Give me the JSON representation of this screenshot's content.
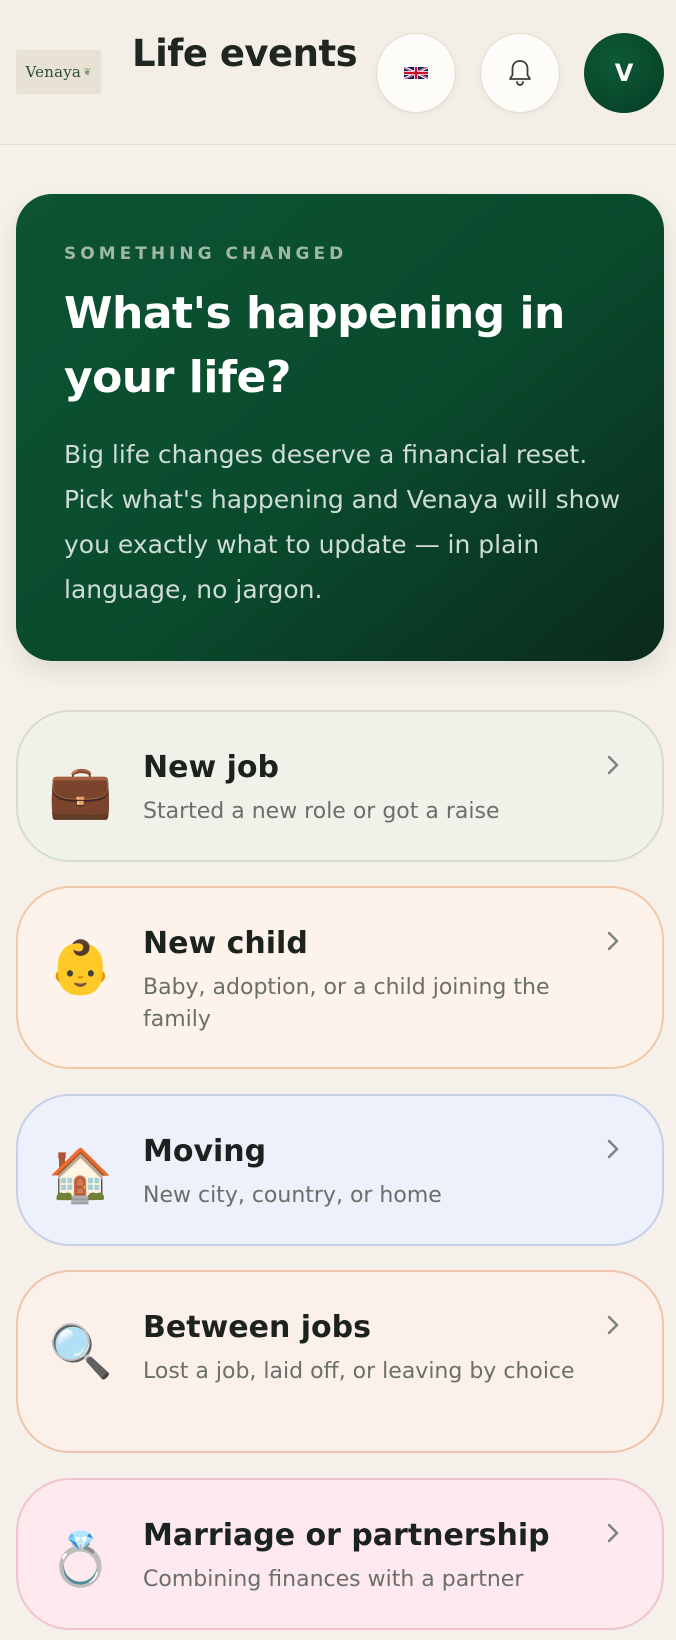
{
  "header": {
    "logo_text": "Venaya",
    "title": "Life events",
    "language_icon": "uk-flag-icon",
    "notifications_icon": "bell-icon",
    "avatar_initial": "V"
  },
  "hero": {
    "eyebrow": "SOMETHING CHANGED",
    "title": "What's happening in your life?",
    "body": "Big life changes deserve a financial reset. Pick what's happening and Venaya will show you exactly what to update — in plain language, no jargon."
  },
  "events": [
    {
      "emoji": "💼",
      "icon": "briefcase-icon",
      "title": "New job",
      "description": "Started a new role or got a raise"
    },
    {
      "emoji": "👶",
      "icon": "baby-icon",
      "title": "New child",
      "description": "Baby, adoption, or a child joining the family"
    },
    {
      "emoji": "🏠",
      "icon": "house-icon",
      "title": "Moving",
      "description": "New city, country, or home"
    },
    {
      "emoji": "🔍",
      "icon": "magnifier-icon",
      "title": "Between jobs",
      "description": "Lost a job, laid off, or leaving by choice"
    },
    {
      "emoji": "💍",
      "icon": "ring-icon",
      "title": "Marriage or partnership",
      "description": "Combining finances with a partner"
    }
  ],
  "colors": {
    "brand_green": "#0a4a2d",
    "background": "#f5f1ea"
  }
}
